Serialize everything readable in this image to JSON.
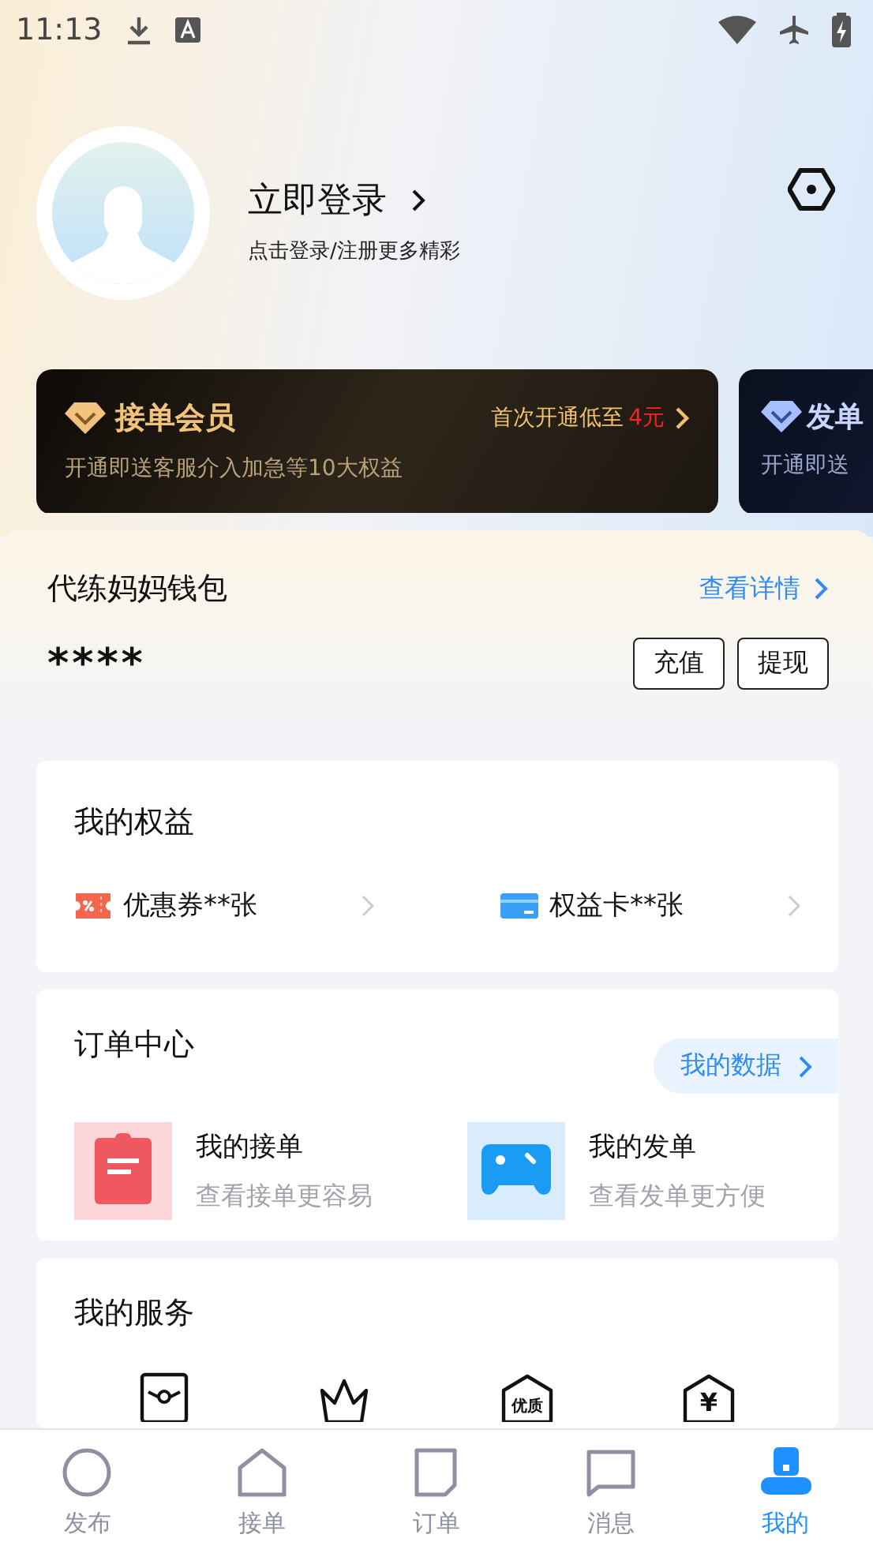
{
  "status_bar": {
    "time": "11:13"
  },
  "profile": {
    "login": "立即登录",
    "hint": "点击登录/注册更多精彩"
  },
  "memberships": [
    {
      "kind": "gold",
      "title": "接单会员",
      "offer": "首次开通低至",
      "price": "4元",
      "subtitle": "开通即送客服介入加急等10大权益"
    },
    {
      "kind": "blue",
      "title": "发单",
      "subtitle": "开通即送"
    }
  ],
  "wallet": {
    "title": "代练妈妈钱包",
    "link": "查看详情",
    "balance": "****",
    "buttons": [
      "充值",
      "提现"
    ]
  },
  "benefits": {
    "title": "我的权益",
    "items": [
      {
        "kind": "coupon",
        "label": "优惠券**张"
      },
      {
        "kind": "card",
        "label": "权益卡**张"
      }
    ]
  },
  "orders": {
    "title": "订单中心",
    "data_link": "我的数据",
    "items": [
      {
        "kind": "taken",
        "title": "我的接单",
        "subtitle": "查看接单更容易"
      },
      {
        "kind": "posted",
        "title": "我的发单",
        "subtitle": "查看发单更方便"
      }
    ]
  },
  "services": {
    "title": "我的服务",
    "items": [
      {
        "kind": "envelope"
      },
      {
        "kind": "crown"
      },
      {
        "kind": "house",
        "glyph": "优质"
      },
      {
        "kind": "house",
        "glyph": "¥"
      }
    ]
  },
  "tabs": [
    {
      "label": "发布",
      "kind": "circle",
      "selected": false
    },
    {
      "label": "接单",
      "kind": "house",
      "selected": false
    },
    {
      "label": "订单",
      "kind": "note",
      "selected": false
    },
    {
      "label": "消息",
      "kind": "chat",
      "selected": false
    },
    {
      "label": "我的",
      "kind": "person",
      "selected": true
    }
  ]
}
